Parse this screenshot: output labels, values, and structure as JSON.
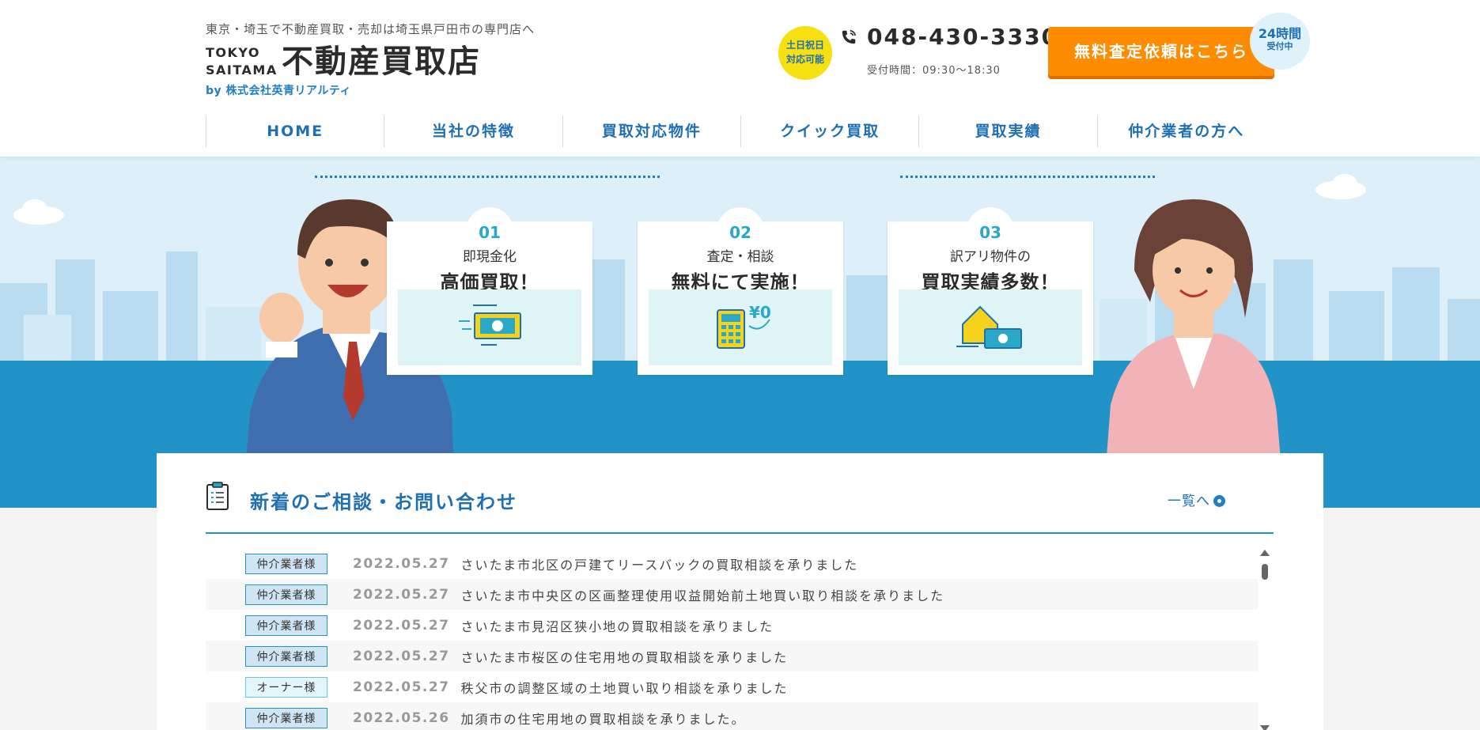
{
  "header": {
    "tagline": "東京・埼玉で不動産買取・売却は埼玉県戸田市の専門店へ",
    "logo_en_line1": "TOKYO",
    "logo_en_line2": "SAITAMA",
    "logo_ja": "不動産買取店",
    "logo_by": "by 株式会社英青リアルティ",
    "weekend_badge_line1": "土日祝日",
    "weekend_badge_line2": "対応可能",
    "phone": "048-430-3330",
    "hours": "受付時間：09:30〜18:30",
    "cta_label": "無料査定依頼はこちら",
    "badge_24_line1": "24時間",
    "badge_24_line2": "受付中"
  },
  "nav": [
    "HOME",
    "当社の特徴",
    "買取対応物件",
    "クイック買取",
    "買取実績",
    "仲介業者の方へ"
  ],
  "hero": {
    "features": [
      {
        "num": "01",
        "sub": "即現金化",
        "main": "高価買取！",
        "icon": "cash-icon"
      },
      {
        "num": "02",
        "sub": "査定・相談",
        "main": "無料にて実施！",
        "icon": "calculator-yen-icon"
      },
      {
        "num": "03",
        "sub": "訳アリ物件の",
        "main": "買取実績多数！",
        "icon": "house-cash-icon"
      }
    ],
    "colors": {
      "sky": "#ddeff9",
      "band": "#2293c6",
      "headline": "#f6d21a"
    }
  },
  "news": {
    "title": "新着のご相談・お問い合わせ",
    "more_label": "一覧へ",
    "items": [
      {
        "tag": "仲介業者様",
        "date": "2022.05.27",
        "text": "さいたま市北区の戸建てリースバックの買取相談を承りました"
      },
      {
        "tag": "仲介業者様",
        "date": "2022.05.27",
        "text": "さいたま市中央区の区画整理使用収益開始前土地買い取り相談を承りました"
      },
      {
        "tag": "仲介業者様",
        "date": "2022.05.27",
        "text": "さいたま市見沼区狭小地の買取相談を承りました"
      },
      {
        "tag": "仲介業者様",
        "date": "2022.05.27",
        "text": "さいたま市桜区の住宅用地の買取相談を承りました"
      },
      {
        "tag": "オーナー様",
        "date": "2022.05.27",
        "text": "秩父市の調整区域の土地買い取り相談を承りました"
      },
      {
        "tag": "仲介業者様",
        "date": "2022.05.26",
        "text": "加須市の住宅用地の買取相談を承りました。"
      }
    ]
  }
}
